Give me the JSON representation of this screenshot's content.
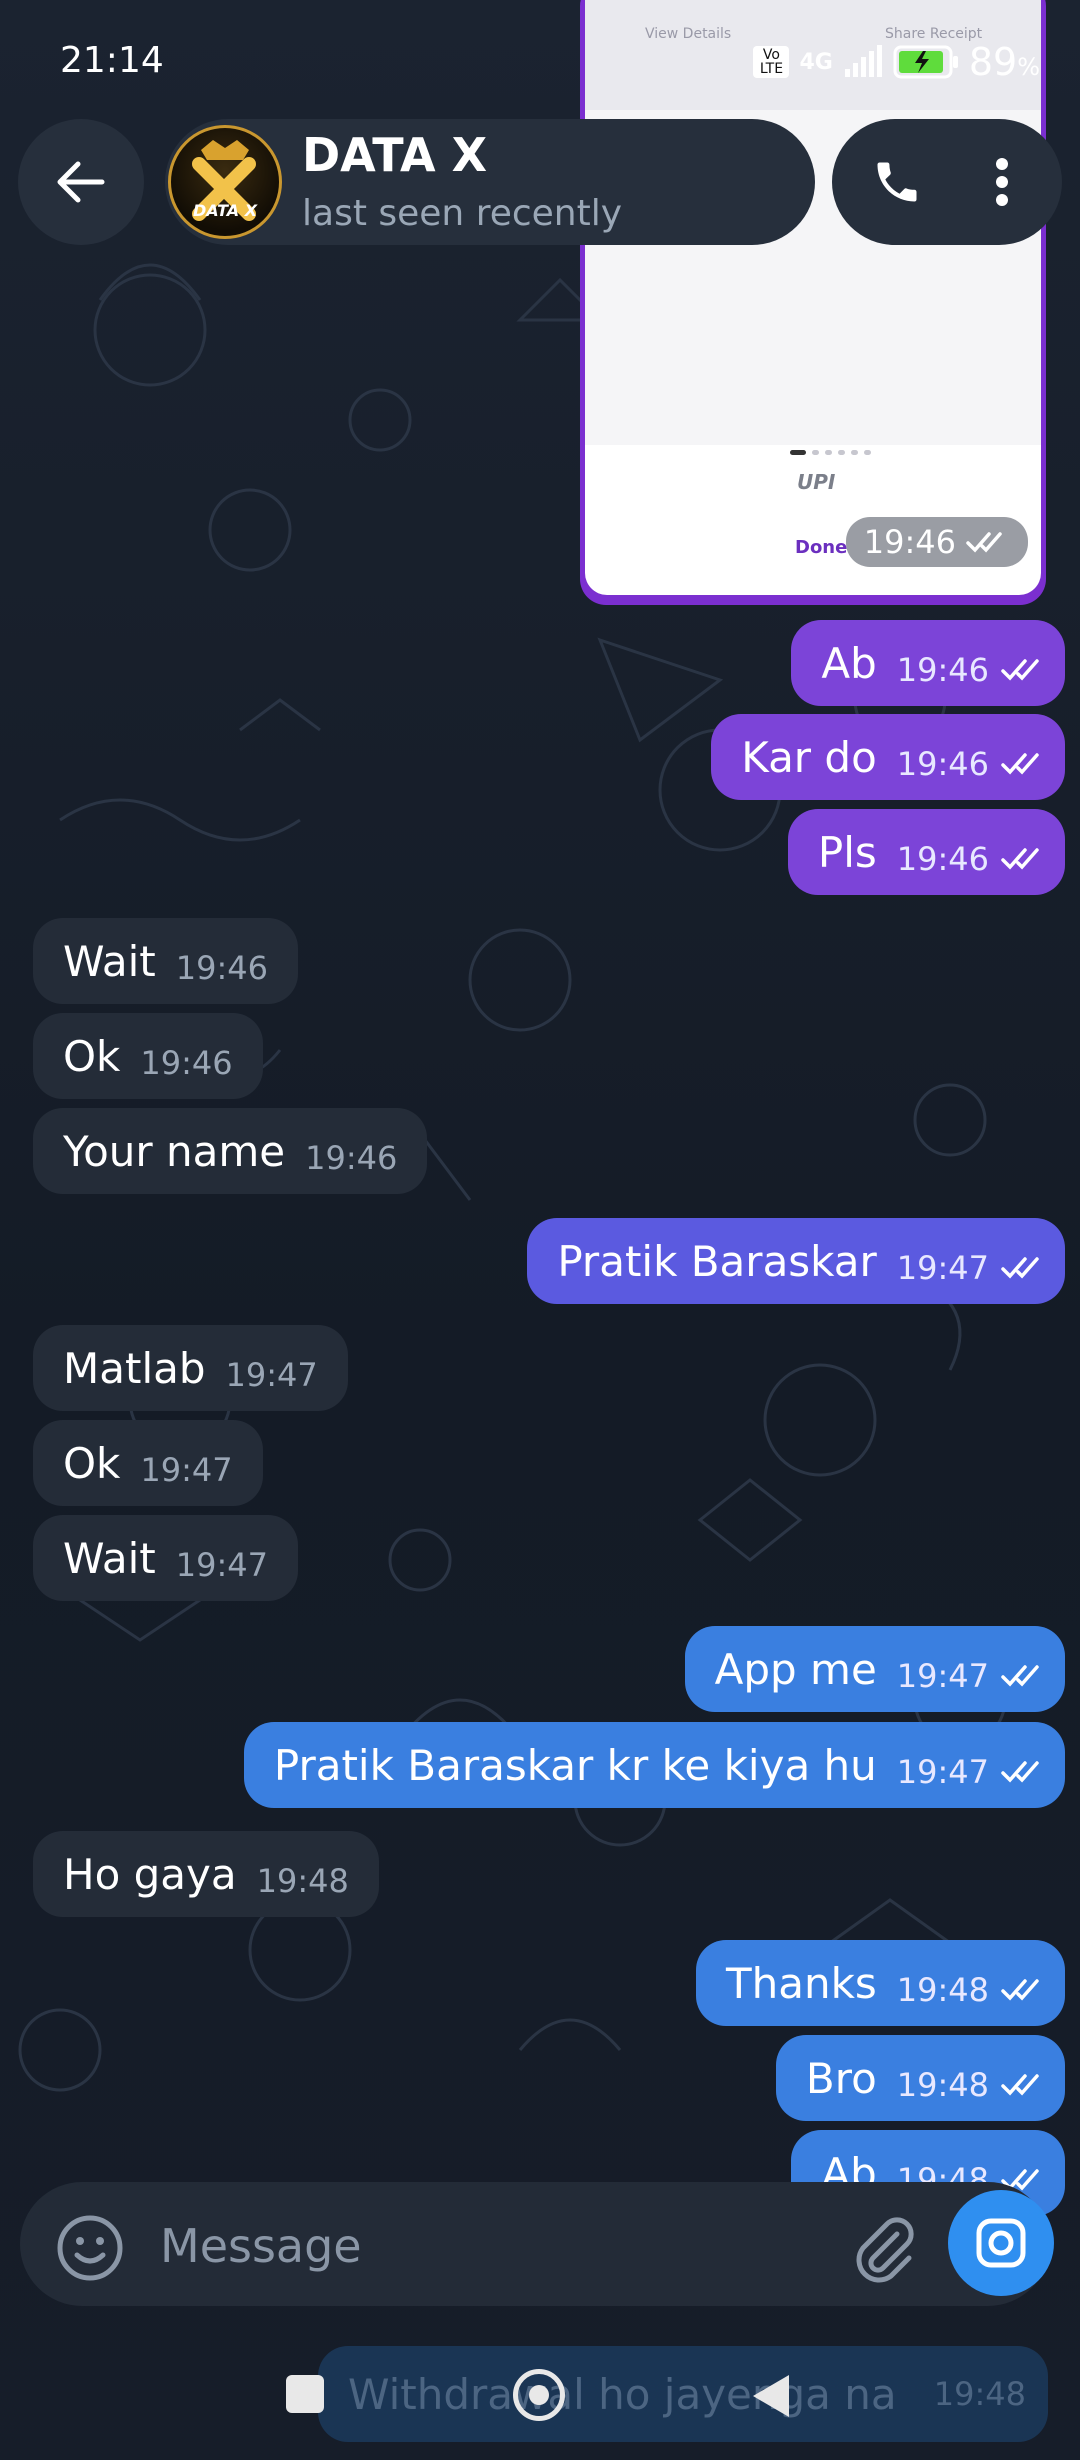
{
  "status_bar": {
    "time": "21:14",
    "network": "4G",
    "volte": "Vo LTE",
    "battery": "89",
    "battery_unit": "%"
  },
  "header": {
    "title": "DATA X",
    "subtitle": "last seen recently",
    "avatar_text": "DATA X"
  },
  "screenshot": {
    "top_left": "View Details",
    "top_right": "Share Receipt",
    "upi_label": "UPI",
    "done_label": "Done",
    "time": "19:46"
  },
  "messages": [
    {
      "text": "Ab",
      "time": "19:46"
    },
    {
      "text": "Kar do",
      "time": "19:46"
    },
    {
      "text": "Pls",
      "time": "19:46"
    },
    {
      "text": "Wait",
      "time": "19:46"
    },
    {
      "text": "Ok",
      "time": "19:46"
    },
    {
      "text": "Your name",
      "time": "19:46"
    },
    {
      "text": "Pratik Baraskar",
      "time": "19:47"
    },
    {
      "text": "Matlab",
      "time": "19:47"
    },
    {
      "text": "Ok",
      "time": "19:47"
    },
    {
      "text": "Wait",
      "time": "19:47"
    },
    {
      "text": "App me",
      "time": "19:47"
    },
    {
      "text": "Pratik Baraskar kr ke kiya hu",
      "time": "19:47"
    },
    {
      "text": "Ho gaya",
      "time": "19:48"
    },
    {
      "text": "Thanks",
      "time": "19:48"
    },
    {
      "text": "Bro",
      "time": "19:48"
    },
    {
      "text": "Ab",
      "time": "19:48"
    }
  ],
  "ghost_message": {
    "text": "Withdrawal ho jayenga na",
    "time": "19:48"
  },
  "input": {
    "placeholder": "Message"
  },
  "colors": {
    "outgoing_purple": "#7c44d8",
    "outgoing_violet": "#5b5ae0",
    "outgoing_blue": "#3a7fe0",
    "incoming": "#242c38",
    "camera": "#2f8ff0"
  }
}
